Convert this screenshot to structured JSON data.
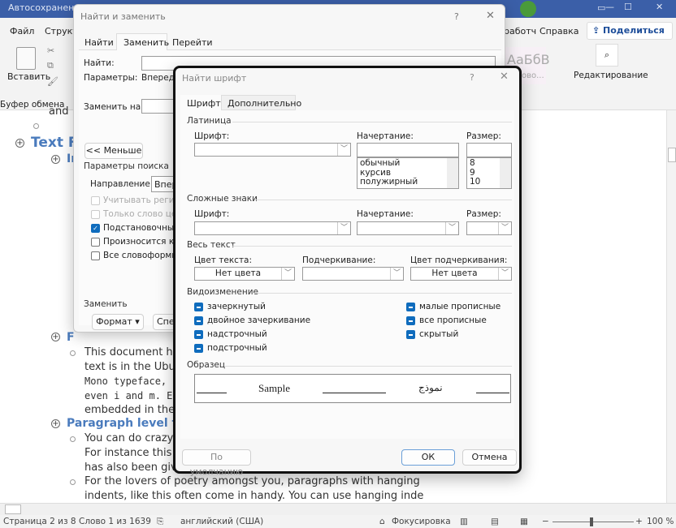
{
  "app": {
    "title": "Автосохранение",
    "tabs": [
      "Файл",
      "Структ",
      "работч",
      "Справка"
    ],
    "share": "Поделиться",
    "paste": "Вставить",
    "clipboard_group": "Буфер обмена",
    "styles_preview": "АаБбВ",
    "styles_sub": "ово...",
    "editing": "Редактирование"
  },
  "document": {
    "lines": [
      {
        "kind": "text",
        "text": "and"
      },
      {
        "kind": "heading1",
        "text": "Text F"
      },
      {
        "kind": "heading2",
        "text": "In"
      },
      {
        "kind": "heading2",
        "text": "F"
      },
      {
        "kind": "text",
        "text": "This document ha"
      },
      {
        "kind": "text",
        "text": "text is in the Ubu"
      },
      {
        "kind": "mono",
        "text": "Mono typeface, "
      },
      {
        "kind": "mono",
        "text": "even i and m. Eve"
      },
      {
        "kind": "text",
        "text": "embedded in the"
      },
      {
        "kind": "heading2",
        "text": "Paragraph level fo"
      },
      {
        "kind": "text",
        "text": "You can do crazy"
      },
      {
        "kind": "text",
        "text": "For instance this"
      },
      {
        "kind": "text",
        "text": "has also been give"
      },
      {
        "kind": "text",
        "text": "For the lovers of poetry amongst you, paragraphs with hanging"
      },
      {
        "kind": "text",
        "text": "indents, like this often come in handy. You can use hanging inde"
      }
    ]
  },
  "status": {
    "page": "Страница 2 из 8",
    "words": "Слово 1 из 1639",
    "language": "английский (США)",
    "focus": "Фокусировка",
    "zoom": "100 %",
    "zoom_fraction": 0.5
  },
  "find_replace": {
    "title": "Найти и заменить",
    "tabs": [
      "Найти",
      "Заменить",
      "Перейти"
    ],
    "active_tab": 1,
    "find_label": "Найти:",
    "params_label": "Параметры:",
    "params_value": "Вперед,",
    "replace_label": "Заменить на:",
    "less_button": "<< Меньше",
    "search_params": "Параметры поиска",
    "direction_label": "Направление:",
    "direction_value": "Впер",
    "options": [
      {
        "label": "Учитывать регистр",
        "checked": false,
        "disabled": true
      },
      {
        "label": "Только слово цели",
        "checked": false,
        "disabled": true
      },
      {
        "label": "Подстановочные з",
        "checked": true,
        "disabled": false
      },
      {
        "label": "Произносится как",
        "checked": false,
        "disabled": false
      },
      {
        "label": "Все словоформы",
        "checked": false,
        "disabled": false
      }
    ],
    "replace_section": "Заменить",
    "format_button": "Формат",
    "special_button": "Спец"
  },
  "find_font": {
    "title": "Найти шрифт",
    "help": "?",
    "tabs": [
      "Шрифт",
      "Дополнительно"
    ],
    "latin": "Латиница",
    "font_label": "Шрифт:",
    "style_label": "Начертание:",
    "size_label": "Размер:",
    "styles": [
      "обычный",
      "курсив",
      "полужирный"
    ],
    "sizes": [
      "8",
      "9",
      "10"
    ],
    "complex": "Сложные знаки",
    "complex_font_label": "Шрифт:",
    "complex_style_label": "Начертание:",
    "complex_size_label": "Размер:",
    "all_text": "Весь текст",
    "color_label": "Цвет текста:",
    "color_value": "Нет цвета",
    "underline_label": "Подчеркивание:",
    "underline_color_label": "Цвет подчеркивания:",
    "underline_color_value": "Нет цвета",
    "effects": "Видоизменение",
    "effects_left": [
      "зачеркнутый",
      "двойное зачеркивание",
      "надстрочный",
      "подстрочный"
    ],
    "effects_right": [
      "малые прописные",
      "все прописные",
      "скрытый"
    ],
    "preview": "Образец",
    "sample_latin": "Sample",
    "sample_arabic": "نموذج",
    "default_button": "По умолчанию",
    "ok": "ОК",
    "cancel": "Отмена"
  }
}
